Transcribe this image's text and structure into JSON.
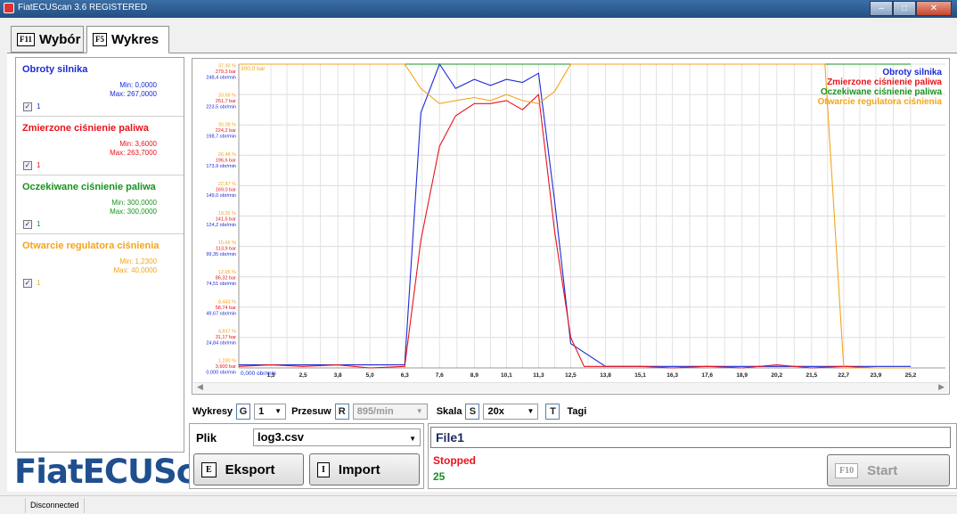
{
  "window": {
    "title": "FiatECUScan 3.6 REGISTERED"
  },
  "tabs": [
    {
      "key": "F11",
      "label": "Wybór"
    },
    {
      "key": "F5",
      "label": "Wykres"
    }
  ],
  "channels": [
    {
      "name": "Obroty silnika",
      "min": "Min: 0,0000",
      "max": "Max: 267,0000",
      "check_value": "1",
      "color": "#1c2ad6"
    },
    {
      "name": "Zmierzone ciśnienie paliwa",
      "min": "Min: 3,6000",
      "max": "Max: 263,7000",
      "check_value": "1",
      "color": "#e8131b"
    },
    {
      "name": "Oczekiwane ciśnienie paliwa",
      "min": "Min: 300,0000",
      "max": "Max: 300,0000",
      "check_value": "1",
      "color": "#18921f"
    },
    {
      "name": "Otwarcie regulatora ciśnienia",
      "min": "Min: 1,2300",
      "max": "Max: 40,0000",
      "check_value": "1",
      "color": "#f4a41b"
    }
  ],
  "logo": "FiatECUScan",
  "chart_data": {
    "type": "line",
    "x": [
      0.1,
      1.3,
      2.5,
      3.8,
      5.0,
      6.3,
      6.9,
      7.6,
      8.2,
      8.9,
      9.5,
      10.1,
      10.7,
      11.3,
      11.9,
      12.5,
      13.8,
      15.1,
      16.3,
      17.6,
      18.9,
      20.2,
      21.5,
      22.7,
      23.9,
      25.2
    ],
    "x_ticks": [
      "1,3",
      "2,5",
      "3,8",
      "5,0",
      "6,3",
      "7,6",
      "8,9",
      "10,1",
      "11,3",
      "12,5",
      "13,8",
      "15,1",
      "16,3",
      "17,6",
      "18,9",
      "20,2",
      "21,5",
      "22,7",
      "23,9",
      "25,2"
    ],
    "xlim": [
      0.1,
      26.5
    ],
    "ylim": [
      0,
      1
    ],
    "x_start_label": "0,000 obr/min",
    "top_value_label": "300,0 bar",
    "y_tick_labels": [
      [
        "37,30 %",
        "279,3 bar",
        "248,4 obr/min"
      ],
      [
        "33,69 %",
        "251,7 bar",
        "223,5 obr/min"
      ],
      [
        "30,08 %",
        "224,2 bar",
        "198,7 obr/min"
      ],
      [
        "26,48 %",
        "196,6 bar",
        "173,9 obr/min"
      ],
      [
        "22,87 %",
        "169,0 bar",
        "149,0 obr/min"
      ],
      [
        "19,26 %",
        "141,5 bar",
        "124,2 obr/min"
      ],
      [
        "15,66 %",
        "113,9 bar",
        "99,35 obr/min"
      ],
      [
        "12,05 %",
        "86,32 bar",
        "74,51 obr/min"
      ],
      [
        "8,443 %",
        "58,74 bar",
        "49,67 obr/min"
      ],
      [
        "4,837 %",
        "31,17 bar",
        "24,84 obr/min"
      ],
      [
        "1,230 %",
        "3,600 bar",
        "0,000 obr/min"
      ]
    ],
    "series": [
      {
        "name": "Obroty silnika",
        "color": "#1c2ad6",
        "points": [
          [
            0.1,
            0.01
          ],
          [
            6.3,
            0.01
          ],
          [
            6.9,
            0.84
          ],
          [
            7.6,
            1.0
          ],
          [
            8.2,
            0.92
          ],
          [
            8.9,
            0.95
          ],
          [
            9.5,
            0.93
          ],
          [
            10.1,
            0.95
          ],
          [
            10.7,
            0.94
          ],
          [
            11.3,
            0.97
          ],
          [
            11.9,
            0.55
          ],
          [
            12.5,
            0.08
          ],
          [
            13.8,
            0.005
          ],
          [
            25.2,
            0.005
          ]
        ]
      },
      {
        "name": "Zmierzone ciśnienie paliwa",
        "color": "#e8131b",
        "points": [
          [
            0.1,
            0.005
          ],
          [
            1.3,
            0.01
          ],
          [
            2.5,
            0.005
          ],
          [
            3.8,
            0.01
          ],
          [
            5.0,
            0.0
          ],
          [
            6.3,
            0.005
          ],
          [
            6.9,
            0.42
          ],
          [
            7.6,
            0.73
          ],
          [
            8.2,
            0.83
          ],
          [
            8.9,
            0.87
          ],
          [
            9.5,
            0.87
          ],
          [
            10.1,
            0.88
          ],
          [
            10.7,
            0.85
          ],
          [
            11.3,
            0.9
          ],
          [
            11.9,
            0.45
          ],
          [
            12.5,
            0.1
          ],
          [
            13.0,
            0.005
          ],
          [
            15.1,
            0.005
          ],
          [
            16.3,
            0.0
          ],
          [
            17.6,
            0.005
          ],
          [
            18.9,
            0.0
          ],
          [
            20.2,
            0.01
          ],
          [
            21.5,
            0.0
          ],
          [
            22.7,
            0.005
          ],
          [
            23.9,
            0.0
          ],
          [
            25.2,
            0.0
          ]
        ]
      },
      {
        "name": "Oczekiwane ciśnienie paliwa",
        "color": "#18921f",
        "points": [
          [
            0.1,
            1.0
          ],
          [
            25.2,
            1.0
          ]
        ]
      },
      {
        "name": "Otwarcie regulatora ciśnienia",
        "color": "#f4a41b",
        "points": [
          [
            0.1,
            1.0
          ],
          [
            6.3,
            1.0
          ],
          [
            6.9,
            0.92
          ],
          [
            7.6,
            0.87
          ],
          [
            8.2,
            0.88
          ],
          [
            8.9,
            0.89
          ],
          [
            9.5,
            0.88
          ],
          [
            10.1,
            0.9
          ],
          [
            10.7,
            0.88
          ],
          [
            11.3,
            0.87
          ],
          [
            11.9,
            0.91
          ],
          [
            12.5,
            1.0
          ],
          [
            22.0,
            1.0
          ],
          [
            22.7,
            0.0
          ],
          [
            25.2,
            0.0
          ]
        ]
      }
    ],
    "legend": [
      "Obroty silnika",
      "Zmierzone ciśnienie paliwa",
      "Oczekiwane ciśnienie paliwa",
      "Otwarcie regulatora ciśnienia"
    ],
    "legend_position": "top-right",
    "grid": true
  },
  "controls": {
    "wykresy_label": "Wykresy",
    "wykresy_key": "G",
    "wykresy_value": "1",
    "przesuw_label": "Przesuw",
    "przesuw_key": "R",
    "przesuw_value": "895/min",
    "skala_label": "Skala",
    "skala_key": "S",
    "skala_value": "20x",
    "tagi_key": "T",
    "tagi_label": "Tagi"
  },
  "file": {
    "plik_label": "Plik",
    "plik_value": "log3.csv",
    "eksport_key": "E",
    "eksport_label": "Eksport",
    "import_key": "I",
    "import_label": "Import"
  },
  "status": {
    "file_name": "File1",
    "state": "Stopped",
    "count": "25",
    "start_key": "F10",
    "start_label": "Start"
  },
  "statusbar": {
    "connection": "Disconnected"
  }
}
